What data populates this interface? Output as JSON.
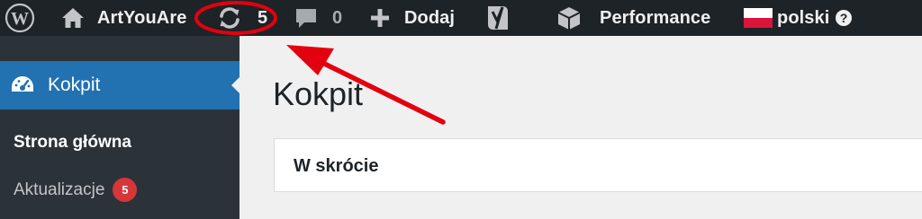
{
  "adminbar": {
    "wp_logo_icon": "wordpress-logo",
    "site_name": "ArtYouAre",
    "updates_count": "5",
    "comments_count": "0",
    "new_label": "Dodaj",
    "yoast_icon": "yoast-seo-logo",
    "performance_label": "Performance",
    "language_label": "polski",
    "help_icon": "question-circle"
  },
  "sidebar": {
    "current_item_label": "Kokpit",
    "current_item_icon": "dashboard-gauge",
    "submenu": {
      "home_label": "Strona główna",
      "updates_label": "Aktualizacje",
      "updates_badge": "5"
    }
  },
  "main": {
    "page_title": "Kokpit",
    "widget_title": "W skrócie"
  },
  "annotation": {
    "color": "#e3000f",
    "shapes": [
      "ellipse-around-updates",
      "arrow"
    ]
  },
  "colors": {
    "adminbar_bg": "#1d2327",
    "sidebar_bg": "#2c3338",
    "accent": "#2271b1",
    "badge": "#d63638"
  }
}
